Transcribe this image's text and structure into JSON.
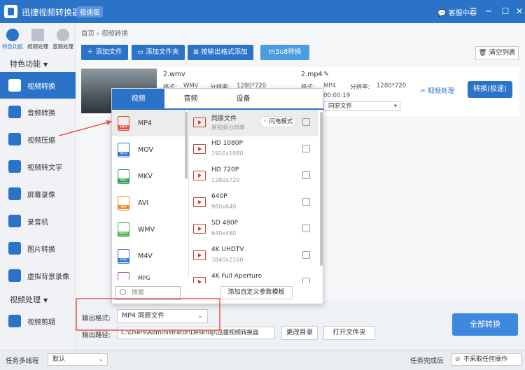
{
  "app": {
    "title": "迅捷视频转换器",
    "edition": "极速版",
    "service": "客服中心"
  },
  "top_tools": [
    {
      "label": "特色功能",
      "icon": "star-icon"
    },
    {
      "label": "视频处理",
      "icon": "film-icon"
    },
    {
      "label": "音频处理",
      "icon": "disc-icon"
    }
  ],
  "sidebar": {
    "section1": "特色功能",
    "items": [
      {
        "label": "视频转换",
        "icon": "video-convert-icon"
      },
      {
        "label": "音频转换",
        "icon": "audio-convert-icon"
      },
      {
        "label": "视频压缩",
        "icon": "compress-icon"
      },
      {
        "label": "视频转文字",
        "icon": "text-icon"
      },
      {
        "label": "屏幕录像",
        "icon": "screen-record-icon"
      },
      {
        "label": "录音机",
        "icon": "recorder-icon"
      },
      {
        "label": "图片转换",
        "icon": "image-convert-icon"
      },
      {
        "label": "虚拟背景录像",
        "icon": "virtual-bg-icon"
      }
    ],
    "section2": "视频处理",
    "items2": [
      {
        "label": "视频剪辑",
        "icon": "video-edit-icon"
      }
    ]
  },
  "breadcrumb": {
    "home": "首页",
    "current": "视频转换"
  },
  "toolbar": {
    "add_file": "添加文件",
    "add_folder": "添加文件夹",
    "add_by_format": "按输出格式添加",
    "m3u8": "m3u8转换",
    "clear_list": "清空列表"
  },
  "file": {
    "src_name": "2.wmv",
    "src_fmt_label": "格式:",
    "src_fmt": "WMV",
    "src_res_label": "分辨率:",
    "src_res": "1280*720",
    "out_name": "2.mp4",
    "out_fmt_label": "格式:",
    "out_fmt": "MP4",
    "out_res_label": "分辨率:",
    "out_res": "1280*720",
    "out_time": "00:00:19",
    "out_preset": "同原文件",
    "process": "视频处理",
    "convert": "转换(极速)"
  },
  "popup": {
    "tabs": [
      "视频",
      "音频",
      "设备"
    ],
    "formats": [
      {
        "name": "MP4",
        "color": "#e0533a"
      },
      {
        "name": "MOV",
        "color": "#2b73c9"
      },
      {
        "name": "MKV",
        "color": "#2e9e4f"
      },
      {
        "name": "AVI",
        "color": "#f08a24"
      },
      {
        "name": "WMV",
        "color": "#4caf50"
      },
      {
        "name": "M4V",
        "color": "#2b73c9"
      },
      {
        "name": "MPG",
        "color": "#9b59b6"
      }
    ],
    "presets": [
      {
        "name": "同原文件",
        "res": "原视频分辨率"
      },
      {
        "name": "HD 1080P",
        "res": "1920x1080"
      },
      {
        "name": "HD 720P",
        "res": "1280x720"
      },
      {
        "name": "640P",
        "res": "960x640"
      },
      {
        "name": "SD 480P",
        "res": "640x480"
      },
      {
        "name": "4K UHDTV",
        "res": "3840x2160"
      },
      {
        "name": "4K Full Aperture",
        "res": ""
      }
    ],
    "flash_mode": "闪电模式",
    "search_placeholder": "搜索",
    "add_custom": "添加自定义参数模板"
  },
  "bottom": {
    "format_label": "输出格式:",
    "format_value": "MP4  同原文件",
    "path_label": "输出路径:",
    "path_value": "C:\\Users\\Administrator\\Desktop\\迅捷视频转换器",
    "change_dir": "更改目录",
    "open_folder": "打开文件夹",
    "convert_all": "全部转换"
  },
  "status": {
    "threads_label": "任务多线程",
    "threads_value": "默认",
    "done_label": "任务完成后",
    "done_value": "不采取任何操作"
  }
}
